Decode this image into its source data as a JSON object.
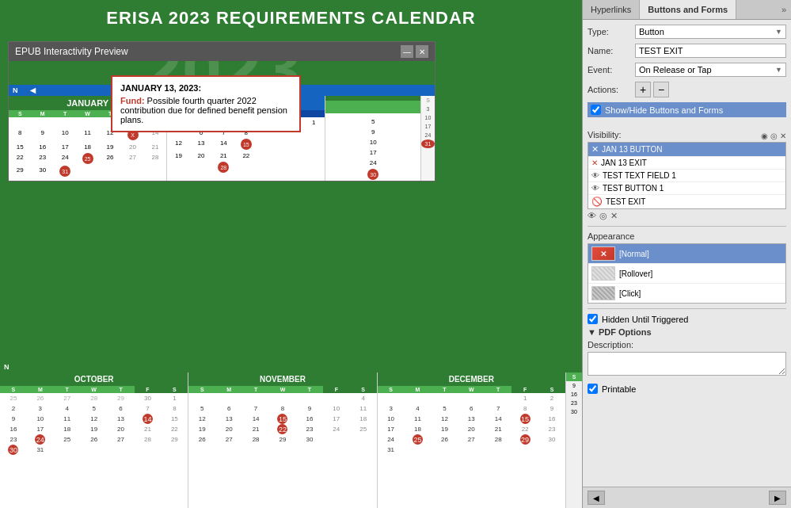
{
  "calendar": {
    "title": "ERISA 2023 REQUIREMENTS CALENDAR",
    "year": "2023",
    "dialog_title": "EPUB Interactivity Preview"
  },
  "panel": {
    "tabs": [
      "Hyperlinks",
      "Buttons and Forms"
    ],
    "active_tab": "Buttons and Forms",
    "more_icon": "»",
    "type_label": "Type:",
    "type_value": "Button",
    "name_label": "Name:",
    "name_value": "TEST EXIT",
    "event_label": "Event:",
    "event_value": "On Release or Tap",
    "actions_label": "Actions:",
    "add_icon": "+",
    "remove_icon": "−",
    "show_hide_label": "Show/Hide Buttons and Forms",
    "visibility_label": "Visibility:",
    "visibility_items": [
      {
        "name": "JAN 13 BUTTON",
        "icon": "x",
        "selected": true
      },
      {
        "name": "JAN 13 EXIT",
        "icon": "x",
        "selected": false
      },
      {
        "name": "TEST TEXT FIELD 1",
        "icon": "eye",
        "selected": false
      },
      {
        "name": "TEST BUTTON 1",
        "icon": "eye",
        "selected": false
      },
      {
        "name": "TEST EXIT",
        "icon": "eye-off",
        "selected": false
      }
    ],
    "extra_icons": "◉ ◎ ✕",
    "appearance_label": "Appearance",
    "appearance_items": [
      {
        "label": "[Normal]",
        "state": "active",
        "selected": true
      },
      {
        "label": "[Rollover]",
        "state": "rollover",
        "selected": false
      },
      {
        "label": "[Click]",
        "state": "click",
        "selected": false
      }
    ],
    "hidden_until_triggered_label": "Hidden Until Triggered",
    "hidden_until_triggered": true,
    "pdf_options_label": "PDF Options",
    "description_label": "Description:",
    "description_value": "",
    "printable_label": "Printable",
    "printable": true
  },
  "popup": {
    "title": "JANUARY 13, 2023:",
    "fund_label": "Fund:",
    "text": "Possible fourth quarter 2022 contribution due for defined benefit pension plans."
  }
}
